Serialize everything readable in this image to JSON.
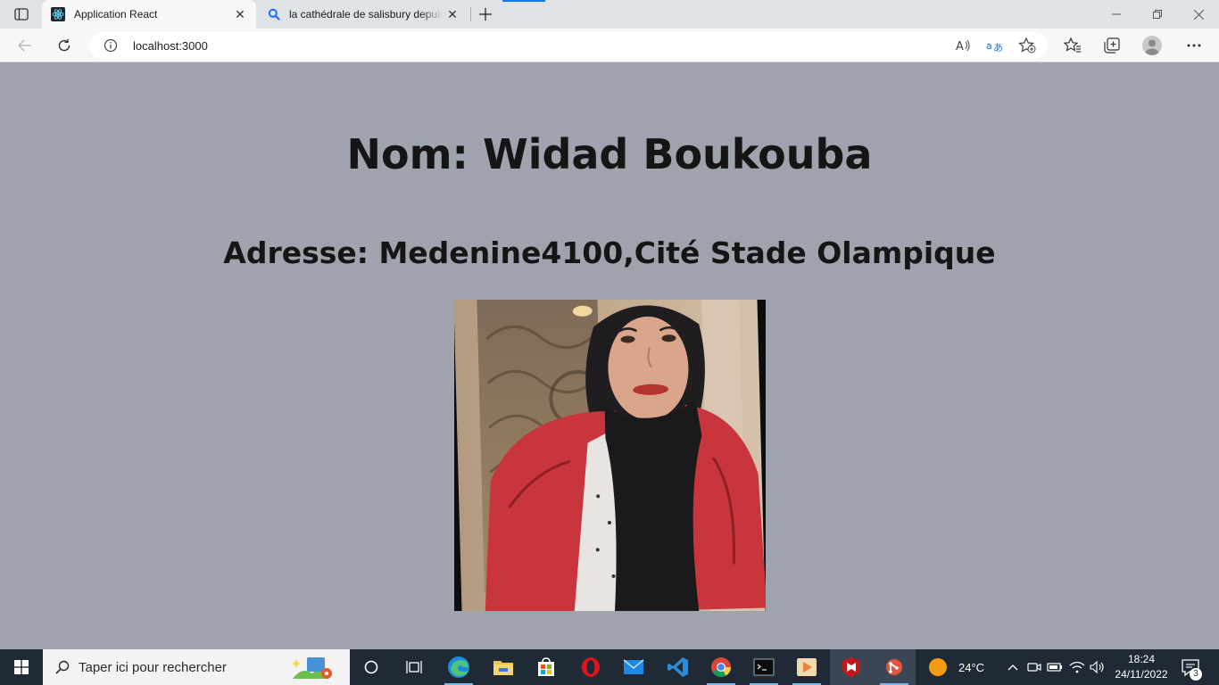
{
  "browser": {
    "tabs": [
      {
        "title": "Application React",
        "active": true,
        "icon": "react-icon"
      },
      {
        "title": "la cathédrale de salisbury depuis",
        "active": false,
        "icon": "search-icon"
      }
    ],
    "url": "localhost:3000",
    "accent_color": "#1a73e8"
  },
  "page": {
    "name_heading": "Nom: Widad Boukouba",
    "address_heading": "Adresse: Medenine4100,Cité Stade Olampique",
    "background_color": "#9ea3ad",
    "photo_icon": "profile-photo"
  },
  "taskbar": {
    "search_placeholder": "Taper ici pour rechercher",
    "apps": [
      "task-view",
      "edge",
      "file-explorer",
      "store",
      "opera",
      "mail",
      "vscode",
      "chrome",
      "terminal",
      "media-player",
      "mcafee",
      "git-app"
    ],
    "weather_temp": "24°C",
    "time": "18:24",
    "date": "24/11/2022",
    "notification_count": "3",
    "background_color": "#1f2a36"
  }
}
